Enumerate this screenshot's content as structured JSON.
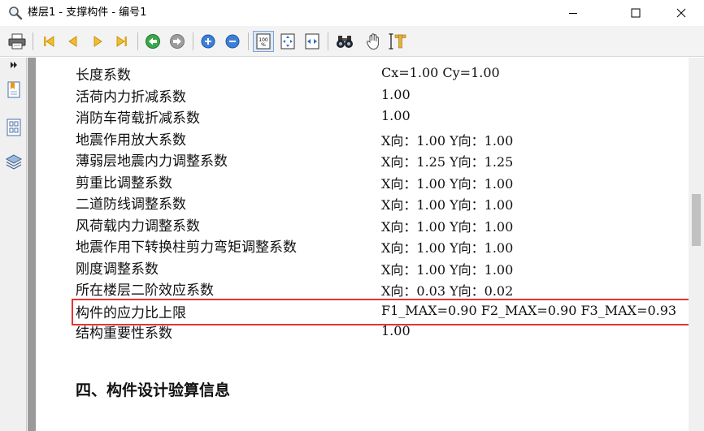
{
  "window": {
    "title": "楼层1 - 支撑构件 - 编号1"
  },
  "toolbar": {
    "buttons": [
      "print-icon",
      "first-page-icon",
      "prev-page-icon",
      "next-page-icon",
      "last-page-icon",
      "back-icon",
      "forward-icon",
      "zoom-in-icon",
      "zoom-out-icon",
      "actual-size-icon",
      "fit-page-icon",
      "fit-width-icon",
      "find-icon",
      "hand-tool-icon",
      "text-select-icon"
    ],
    "actual_size_label": "100 %"
  },
  "report": {
    "rows": [
      {
        "label": "长度系数",
        "value": "Cx=1.00   Cy=1.00"
      },
      {
        "label": "活荷内力折减系数",
        "value": "1.00"
      },
      {
        "label": "消防车荷载折减系数",
        "value": "1.00"
      },
      {
        "label": "地震作用放大系数",
        "value": "X向：1.00 Y向：1.00"
      },
      {
        "label": "薄弱层地震内力调整系数",
        "value": "X向：1.25 Y向：1.25"
      },
      {
        "label": "剪重比调整系数",
        "value": "X向：1.00 Y向：1.00"
      },
      {
        "label": "二道防线调整系数",
        "value": "X向：1.00 Y向：1.00"
      },
      {
        "label": "风荷载内力调整系数",
        "value": "X向：1.00 Y向：1.00"
      },
      {
        "label": "地震作用下转换柱剪力弯矩调整系数",
        "value": "X向：1.00 Y向：1.00"
      },
      {
        "label": "刚度调整系数",
        "value": "X向：1.00 Y向：1.00"
      },
      {
        "label": "所在楼层二阶效应系数",
        "value": "X向：0.03 Y向：0.02"
      },
      {
        "label": "构件的应力比上限",
        "value": "F1_MAX=0.90  F2_MAX=0.90  F3_MAX=0.93"
      },
      {
        "label": "结构重要性系数",
        "value": "1.00"
      }
    ],
    "section_heading": "四、构件设计验算信息"
  },
  "colors": {
    "highlight": "#e63333",
    "toolbar_bg": "#f3f3f3",
    "side_strip": "#9a9a9a"
  }
}
